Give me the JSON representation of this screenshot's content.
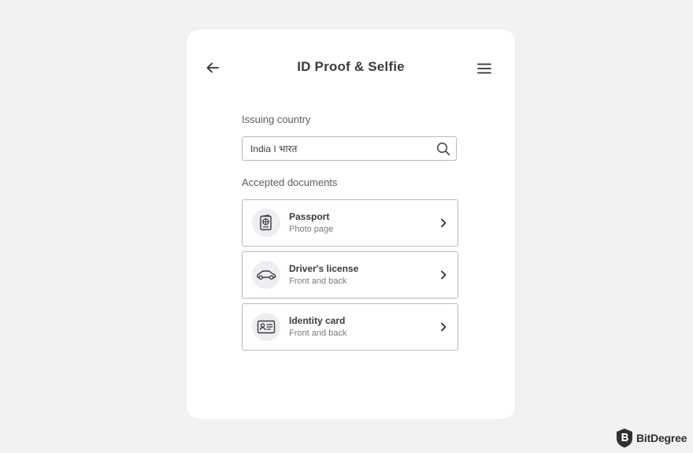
{
  "header": {
    "title": "ID Proof & Selfie",
    "back_icon": "arrow-left-icon",
    "menu_icon": "hamburger-menu-icon"
  },
  "country": {
    "label": "Issuing country",
    "value": "India I भारत",
    "search_icon": "search-icon"
  },
  "documents": {
    "label": "Accepted documents",
    "items": [
      {
        "title": "Passport",
        "subtitle": "Photo page",
        "icon": "passport-icon"
      },
      {
        "title": "Driver's license",
        "subtitle": "Front and back",
        "icon": "car-icon"
      },
      {
        "title": "Identity card",
        "subtitle": "Front and back",
        "icon": "id-card-icon"
      }
    ],
    "chevron_icon": "chevron-right-icon"
  },
  "brand": {
    "name": "BitDegree",
    "icon": "bitdegree-logo-icon"
  },
  "colors": {
    "background": "#f2f2f2",
    "card": "#ffffff",
    "border": "#b9bbbf",
    "icon_circle": "#eceef2",
    "text_primary": "#3a3b3e",
    "text_secondary": "#7a7c81"
  }
}
